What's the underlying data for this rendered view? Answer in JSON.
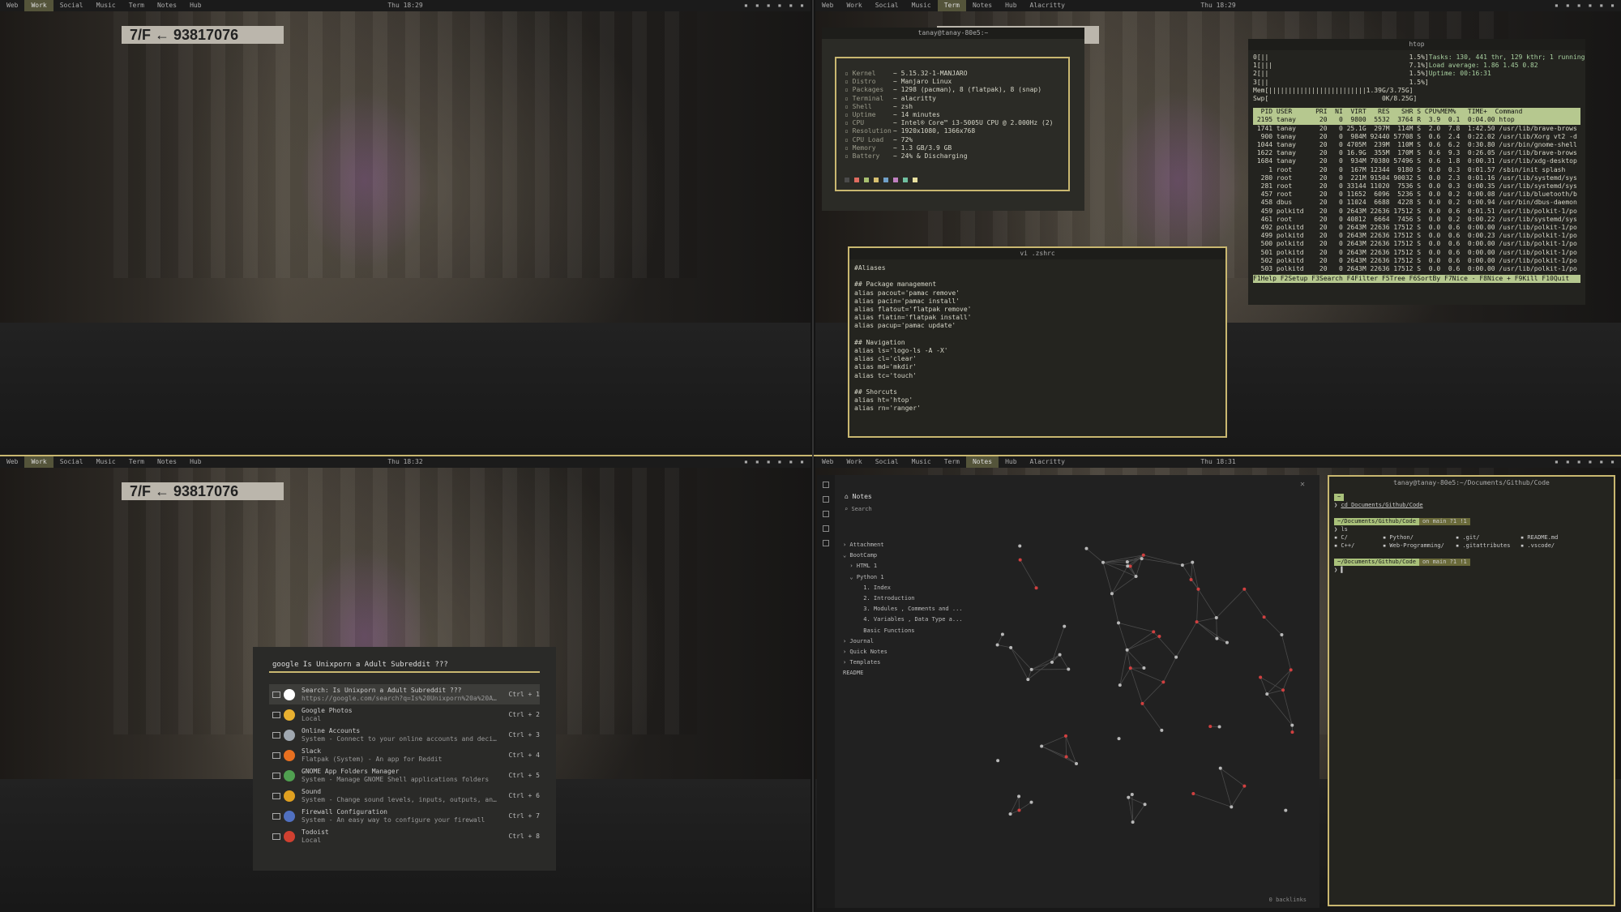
{
  "workspaces": [
    "Web",
    "Work",
    "Social",
    "Music",
    "Term",
    "Notes",
    "Hub"
  ],
  "quads": {
    "q1": {
      "active": "Work",
      "clock": "Thu 18:29",
      "extra": ""
    },
    "q2": {
      "active": "Term",
      "clock": "Thu 18:29",
      "extra": "Alacritty"
    },
    "q3": {
      "active": "Work",
      "clock": "Thu 18:32",
      "extra": ""
    },
    "q4": {
      "active": "Notes",
      "clock": "Thu 18:31",
      "extra": "Alacritty"
    }
  },
  "wallpaper_sign": "7/F ← 93817076",
  "neofetch": {
    "title": "tanay@tanay-80e5:~",
    "rows": [
      [
        "Kernel",
        "5.15.32-1-MANJARO"
      ],
      [
        "Distro",
        "Manjaro Linux"
      ],
      [
        "Packages",
        "1298 (pacman), 8 (flatpak), 8 (snap)"
      ],
      [
        "Terminal",
        "alacritty"
      ],
      [
        "Shell",
        "zsh"
      ],
      [
        "Uptime",
        "14 minutes"
      ],
      [
        "CPU",
        "Intel® Core™ i3-5005U CPU @ 2.000Hz (2)"
      ],
      [
        "Resolution",
        "1920x1080, 1366x768"
      ],
      [
        "CPU Load",
        "72%"
      ],
      [
        "Memory",
        "1.3 GB/3.9 GB"
      ],
      [
        "Battery",
        "24% & Discharging"
      ]
    ],
    "colors": [
      "#4a4a4a",
      "#e06c60",
      "#a8c070",
      "#d8c070",
      "#70a0c8",
      "#c080c0",
      "#70c0a0",
      "#e8e0a0"
    ]
  },
  "htop": {
    "title": "htop",
    "cpu_lines": [
      "0[||                                    1.5%]",
      "1[|||                                   7.1%]",
      "2[||                                    1.5%]",
      "3[||                                    1.5%]"
    ],
    "mem": "Mem[|||||||||||||||||||||||||1.39G/3.75G]",
    "swp": "Swp[                             0K/8.25G]",
    "summary": [
      "Tasks: 130, 441 thr, 129 kthr; 1 running",
      "Load average: 1.86 1.45 0.82",
      "Uptime: 00:16:31"
    ],
    "header": "  PID USER      PRI  NI  VIRT   RES   SHR S CPU%MEM%   TIME+  Command",
    "rows": [
      " 2195 tanay      20   0  9800  5532  3764 R  3.9  0.1  0:04.00 htop",
      " 1741 tanay      20   0 25.1G  297M  114M S  2.0  7.8  1:42.50 /usr/lib/brave-brows",
      "  900 tanay      20   0  984M 92440 57708 S  0.6  2.4  0:22.02 /usr/lib/Xorg vt2 -d",
      " 1044 tanay      20   0 4705M  239M  110M S  0.6  6.2  0:30.80 /usr/bin/gnome-shell",
      " 1622 tanay      20   0 16.9G  355M  170M S  0.6  9.3  0:26.05 /usr/lib/brave-brows",
      " 1684 tanay      20   0  934M 70380 57496 S  0.6  1.8  0:00.31 /usr/lib/xdg-desktop",
      "    1 root       20   0  167M 12344  9180 S  0.0  0.3  0:01.57 /sbin/init splash",
      "  280 root       20   0  221M 91504 90032 S  0.0  2.3  0:01.16 /usr/lib/systemd/sys",
      "  281 root       20   0 33144 11020  7536 S  0.0  0.3  0:00.35 /usr/lib/systemd/sys",
      "  457 root       20   0 11652  6096  5236 S  0.0  0.2  0:00.08 /usr/lib/bluetooth/b",
      "  458 dbus       20   0 11024  6688  4228 S  0.0  0.2  0:00.94 /usr/bin/dbus-daemon",
      "  459 polkitd    20   0 2643M 22636 17512 S  0.0  0.6  0:01.51 /usr/lib/polkit-1/po",
      "  461 root       20   0 40812  6664  7456 S  0.0  0.2  0:00.22 /usr/lib/systemd/sys",
      "  492 polkitd    20   0 2643M 22636 17512 S  0.0  0.6  0:00.00 /usr/lib/polkit-1/po",
      "  499 polkitd    20   0 2643M 22636 17512 S  0.0  0.6  0:00.23 /usr/lib/polkit-1/po",
      "  500 polkitd    20   0 2643M 22636 17512 S  0.0  0.6  0:00.00 /usr/lib/polkit-1/po",
      "  501 polkitd    20   0 2643M 22636 17512 S  0.0  0.6  0:00.00 /usr/lib/polkit-1/po",
      "  502 polkitd    20   0 2643M 22636 17512 S  0.0  0.6  0:00.00 /usr/lib/polkit-1/po",
      "  503 polkitd    20   0 2643M 22636 17512 S  0.0  0.6  0:00.00 /usr/lib/polkit-1/po"
    ],
    "fkeys": "F1Help F2Setup F3Search F4Filter F5Tree F6SortBy F7Nice - F8Nice + F9Kill F10Quit"
  },
  "vim": {
    "title": "vi .zshrc",
    "lines": [
      "#Aliases",
      "",
      "## Package management",
      "alias pacout='pamac remove'",
      "alias pacin='pamac install'",
      "alias flatout='flatpak remove'",
      "alias flatin='flatpak install'",
      "alias pacup='pamac update'",
      "",
      "## Navigation",
      "alias ls='logo-ls -A -X'",
      "alias cl='clear'",
      "alias md='mkdir'",
      "alias tc='touch'",
      "",
      "## Shorcuts",
      "alias ht='htop'",
      "alias rn='ranger'"
    ]
  },
  "launcher": {
    "query": "google Is Unixporn a Adult Subreddit ???",
    "results": [
      {
        "title": "Search: Is Unixporn a Adult Subreddit ???",
        "sub": "https://google.com/search?q=Is%20Unixporn%20a%20Adult%20Subreddit%20%3F%3F%3F",
        "key": "Ctrl + 1",
        "color": "#ffffff"
      },
      {
        "title": "Google Photos",
        "sub": "Local",
        "key": "Ctrl + 2",
        "color": "#e8b030"
      },
      {
        "title": "Online Accounts",
        "sub": "System - Connect to your online accounts and decide what to use them for",
        "key": "Ctrl + 3",
        "color": "#a0a8b0"
      },
      {
        "title": "Slack",
        "sub": "Flatpak (System) - An app for Reddit",
        "key": "Ctrl + 4",
        "color": "#e87020"
      },
      {
        "title": "GNOME App Folders Manager",
        "sub": "System - Manage GNOME Shell applications folders",
        "key": "Ctrl + 5",
        "color": "#50a050"
      },
      {
        "title": "Sound",
        "sub": "System - Change sound levels, inputs, outputs, and alert sounds",
        "key": "Ctrl + 6",
        "color": "#e0a020"
      },
      {
        "title": "Firewall Configuration",
        "sub": "System - An easy way to configure your firewall",
        "key": "Ctrl + 7",
        "color": "#5070c0"
      },
      {
        "title": "Todoist",
        "sub": "Local",
        "key": "Ctrl + 8",
        "color": "#d04030"
      }
    ]
  },
  "notes": {
    "header": "Notes",
    "search": "Search",
    "tree": [
      "› Attachment",
      "⌄ BootCamp",
      "  › HTML 1",
      "  ⌄ Python 1",
      "      1. Index",
      "      2. Introduction",
      "      3. Modules , Comments and ...",
      "      4. Variables , Data Type a...",
      "      Basic Functions",
      "› Journal",
      "› Quick Notes",
      "› Templates",
      "README"
    ],
    "status": "0 backlinks"
  },
  "term": {
    "title": "tanay@tanay-80e5:~/Documents/Github/Code",
    "cmd1": "cd Documents/Github/Code",
    "path": "~/Documents/Github/Code",
    "branch": "on main ?1 !1",
    "cmd2": "ls",
    "ls": [
      "C/",
      "Python/",
      ".git/",
      "README.md",
      "C++/",
      "Web-Programming/",
      ".gitattributes",
      ".vscode/"
    ]
  }
}
